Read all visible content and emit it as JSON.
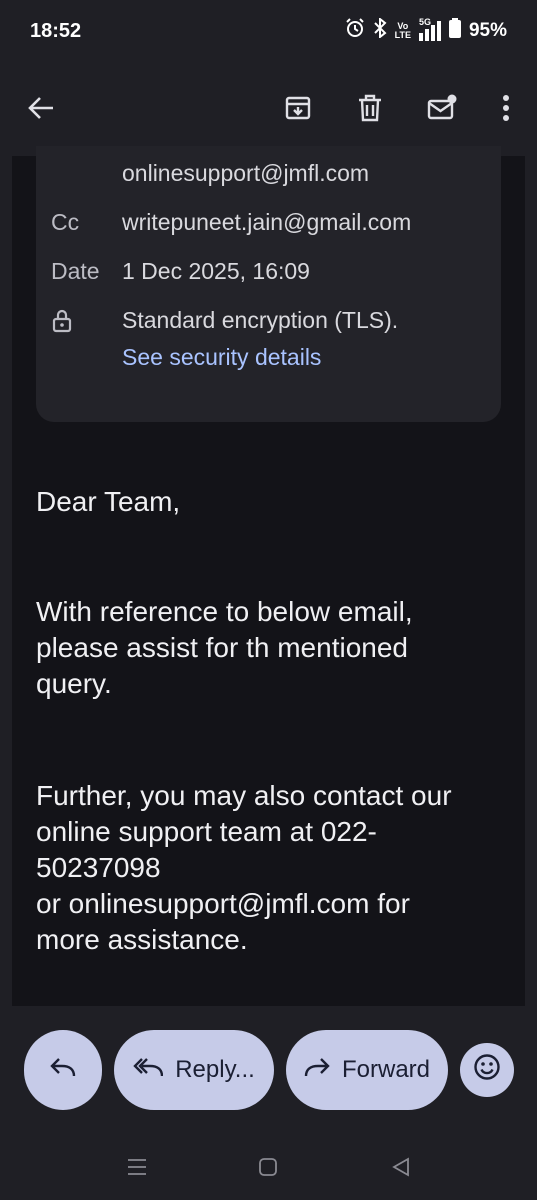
{
  "status_bar": {
    "time": "18:52",
    "network": "5G",
    "volte_top": "Vo",
    "volte_bottom": "LTE",
    "battery": "95%"
  },
  "app_bar": {
    "icons": [
      "back-arrow-icon",
      "archive-icon",
      "delete-icon",
      "mark-unread-icon",
      "more-vert-icon"
    ]
  },
  "details": {
    "to_value": "onlinesupport@jmfl.com",
    "cc_label": "Cc",
    "cc_value": "writepuneet.jain@gmail.com",
    "date_label": "Date",
    "date_value": "1 Dec 2025, 16:09",
    "encryption_text": "Standard encryption (TLS).",
    "security_link": "See security details"
  },
  "body": {
    "greeting": "Dear Team,",
    "paragraph1_line1": "With reference to below email,",
    "paragraph1_line2": "please assist for th mentioned",
    "paragraph1_line3": "query.",
    "paragraph2_line1": "Further, you may also contact our",
    "paragraph2_line2": "online support team at 022-",
    "paragraph2_line3": "50237098",
    "paragraph2_line4": "or onlinesupport@jmfl.com for",
    "paragraph2_line5": "more assistance."
  },
  "actions": {
    "reply_all_label": "Reply...",
    "forward_label": "Forward"
  },
  "colors": {
    "background": "#1f1f25",
    "content": "#131318",
    "card": "#232329",
    "pill": "#c6cbe8",
    "link": "#a9c3ff"
  }
}
